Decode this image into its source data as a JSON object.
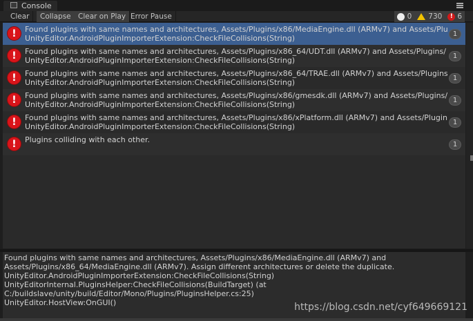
{
  "window": {
    "tab_label": "Console",
    "tab_icon": "console-icon",
    "menu_icon": "hamburger-menu-icon"
  },
  "toolbar": {
    "clear": "Clear",
    "collapse": "Collapse",
    "clear_on_play": "Clear on Play",
    "error_pause": "Error Pause",
    "info_count": "0",
    "warning_count": "730",
    "error_count": "6"
  },
  "log": {
    "entries": [
      {
        "line1": "Found plugins with same names and architectures, Assets/Plugins/x86/MediaEngine.dll (ARMv7) and Assets/Plu",
        "line2": "UnityEditor.AndroidPluginImporterExtension:CheckFileCollisions(String)",
        "count": "1",
        "selected": true
      },
      {
        "line1": "Found plugins with same names and architectures, Assets/Plugins/x86_64/UDT.dll (ARMv7) and Assets/Plugins/",
        "line2": "UnityEditor.AndroidPluginImporterExtension:CheckFileCollisions(String)",
        "count": "1"
      },
      {
        "line1": "Found plugins with same names and architectures, Assets/Plugins/x86_64/TRAE.dll (ARMv7) and Assets/Plugins",
        "line2": "UnityEditor.AndroidPluginImporterExtension:CheckFileCollisions(String)",
        "count": "1"
      },
      {
        "line1": "Found plugins with same names and architectures, Assets/Plugins/x86/gmesdk.dll (ARMv7) and Assets/Plugins/",
        "line2": "UnityEditor.AndroidPluginImporterExtension:CheckFileCollisions(String)",
        "count": "1"
      },
      {
        "line1": "Found plugins with same names and architectures, Assets/Plugins/x86/xPlatform.dll (ARMv7) and Assets/Plugin",
        "line2": "UnityEditor.AndroidPluginImporterExtension:CheckFileCollisions(String)",
        "count": "1"
      },
      {
        "line1": "Plugins colliding with each other.",
        "line2": "",
        "count": "1"
      }
    ]
  },
  "details": {
    "lines": [
      "Found plugins with same names and architectures, Assets/Plugins/x86/MediaEngine.dll (ARMv7) and",
      "Assets/Plugins/x86_64/MediaEngine.dll (ARMv7). Assign different architectures or delete the duplicate.",
      "UnityEditor.AndroidPluginImporterExtension:CheckFileCollisions(String)",
      "UnityEditorInternal.PluginsHelper:CheckFileCollisions(BuildTarget) (at",
      "C:/buildslave/unity/build/Editor/Mono/Plugins/PluginsHelper.cs:25)",
      "UnityEditor.HostView:OnGUI()"
    ]
  },
  "watermark": "https://blog.csdn.net/cyf649669121",
  "colors": {
    "selected_row": "#3c5f91",
    "error_red": "#d9141a",
    "warning_yellow": "#f2c200"
  }
}
